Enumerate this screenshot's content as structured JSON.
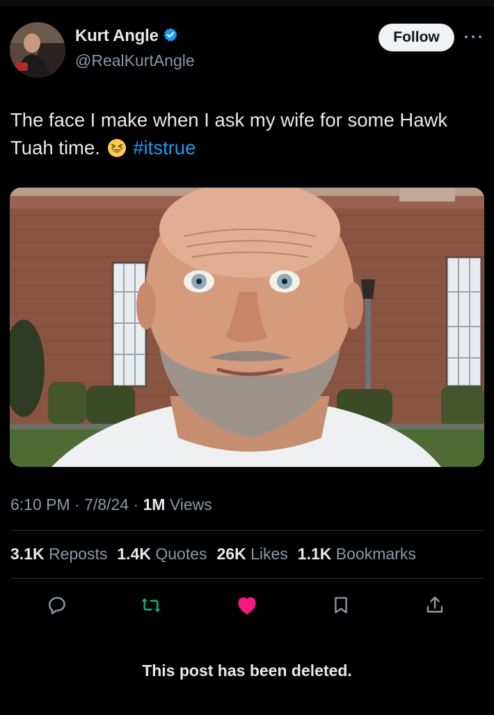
{
  "author": {
    "name": "Kurt Angle",
    "handle": "@RealKurtAngle",
    "verified": true,
    "avatar_icon": "profile-photo"
  },
  "follow_label": "Follow",
  "tweet": {
    "text_before": "The face I make when I ask my wife for some Hawk Tuah time.",
    "emoji": "grinning-squinting-face",
    "hashtag": "#itstrue"
  },
  "media": {
    "description_icon": "photo-closeup-face"
  },
  "meta": {
    "time": "6:10 PM",
    "sep": "·",
    "date": "7/8/24",
    "views_count": "1M",
    "views_label": "Views"
  },
  "stats": [
    {
      "count": "3.1K",
      "label": "Reposts"
    },
    {
      "count": "1.4K",
      "label": "Quotes"
    },
    {
      "count": "26K",
      "label": "Likes"
    },
    {
      "count": "1.1K",
      "label": "Bookmarks"
    }
  ],
  "actions": {
    "reply_icon": "reply-icon",
    "repost_icon": "repost-icon",
    "like_icon": "like-icon",
    "bookmark_icon": "bookmark-icon",
    "share_icon": "share-icon"
  },
  "colors": {
    "link": "#1d9bf0",
    "repost": "#00ba7c",
    "like": "#f91880",
    "verified": "#1d9bf0"
  },
  "deleted_notice": "This post has been deleted."
}
